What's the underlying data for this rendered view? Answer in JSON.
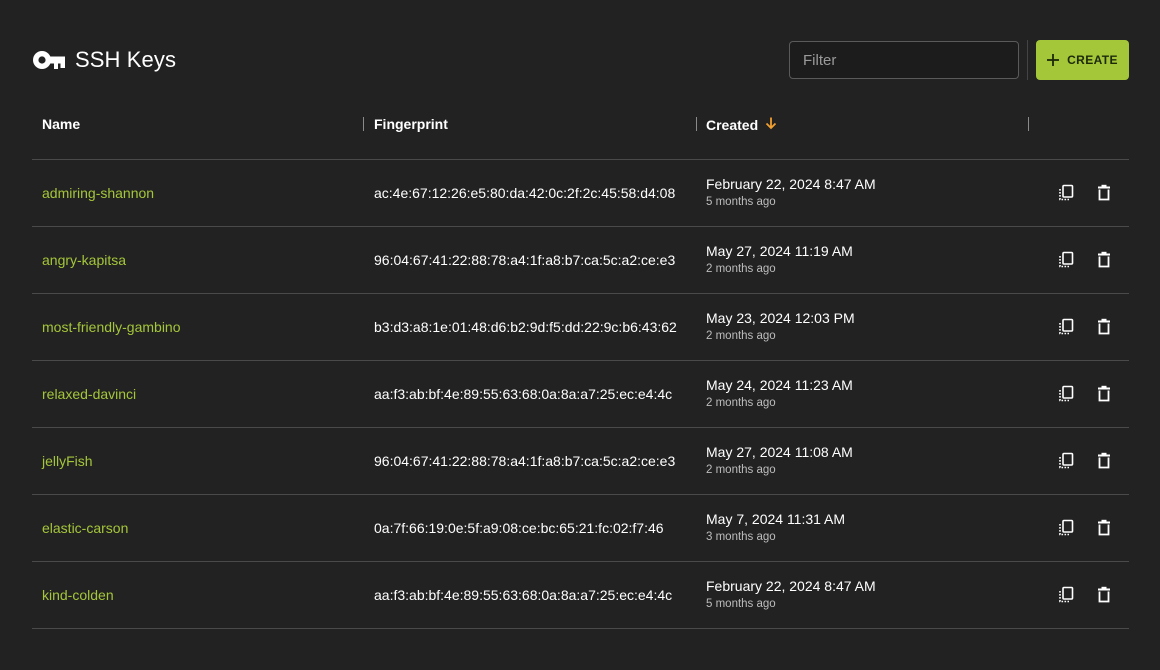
{
  "header": {
    "title": "SSH Keys",
    "title_icon": "key-icon",
    "filter_placeholder": "Filter",
    "filter_value": "",
    "create_label": "CREATE",
    "create_icon": "plus-icon"
  },
  "colors": {
    "accent": "#a4c639",
    "background": "#222222",
    "sort_arrow": "#f0a030"
  },
  "table": {
    "columns": [
      {
        "label": "Name"
      },
      {
        "label": "Fingerprint"
      },
      {
        "label": "Created",
        "sort": "descending",
        "sort_icon": "arrow-down-icon"
      },
      {
        "label": ""
      }
    ],
    "row_actions": [
      "copy-icon",
      "trash-icon"
    ],
    "rows": [
      {
        "name": "admiring-shannon",
        "fingerprint": "ac:4e:67:12:26:e5:80:da:42:0c:2f:2c:45:58:d4:08",
        "created": "February 22, 2024 8:47 AM",
        "ago": "5 months ago"
      },
      {
        "name": "angry-kapitsa",
        "fingerprint": "96:04:67:41:22:88:78:a4:1f:a8:b7:ca:5c:a2:ce:e3",
        "created": "May 27, 2024 11:19 AM",
        "ago": "2 months ago"
      },
      {
        "name": "most-friendly-gambino",
        "fingerprint": "b3:d3:a8:1e:01:48:d6:b2:9d:f5:dd:22:9c:b6:43:62",
        "created": "May 23, 2024 12:03 PM",
        "ago": "2 months ago"
      },
      {
        "name": "relaxed-davinci",
        "fingerprint": "aa:f3:ab:bf:4e:89:55:63:68:0a:8a:a7:25:ec:e4:4c",
        "created": "May 24, 2024 11:23 AM",
        "ago": "2 months ago"
      },
      {
        "name": "jellyFish",
        "fingerprint": "96:04:67:41:22:88:78:a4:1f:a8:b7:ca:5c:a2:ce:e3",
        "created": "May 27, 2024 11:08 AM",
        "ago": "2 months ago"
      },
      {
        "name": "elastic-carson",
        "fingerprint": "0a:7f:66:19:0e:5f:a9:08:ce:bc:65:21:fc:02:f7:46",
        "created": "May 7, 2024 11:31 AM",
        "ago": "3 months ago"
      },
      {
        "name": "kind-colden",
        "fingerprint": "aa:f3:ab:bf:4e:89:55:63:68:0a:8a:a7:25:ec:e4:4c",
        "created": "February 22, 2024 8:47 AM",
        "ago": "5 months ago"
      }
    ]
  }
}
